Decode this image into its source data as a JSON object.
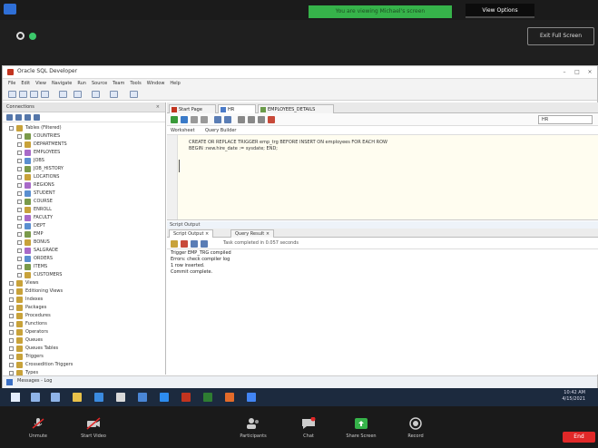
{
  "zoom_top": {
    "share_banner": "You are viewing Michael's screen",
    "view_options": "View Options",
    "full_screen": "Exit Full Screen"
  },
  "window": {
    "title": "Oracle SQL Developer",
    "minimize": "–",
    "maximize": "□",
    "close": "×"
  },
  "menubar": [
    "File",
    "Edit",
    "View",
    "Navigate",
    "Run",
    "Source",
    "Team",
    "Tools",
    "Window",
    "Help"
  ],
  "connections": {
    "header": "Connections",
    "close": "×",
    "tree": [
      {
        "label": "Tables (Filtered)",
        "depth": 0
      },
      {
        "label": "COUNTRIES",
        "depth": 1
      },
      {
        "label": "DEPARTMENTS",
        "depth": 1
      },
      {
        "label": "EMPLOYEES",
        "depth": 1
      },
      {
        "label": "JOBS",
        "depth": 1
      },
      {
        "label": "JOB_HISTORY",
        "depth": 1
      },
      {
        "label": "LOCATIONS",
        "depth": 1
      },
      {
        "label": "REGIONS",
        "depth": 1
      },
      {
        "label": "STUDENT",
        "depth": 1
      },
      {
        "label": "COURSE",
        "depth": 1
      },
      {
        "label": "ENROLL",
        "depth": 1
      },
      {
        "label": "FACULTY",
        "depth": 1
      },
      {
        "label": "DEPT",
        "depth": 1
      },
      {
        "label": "EMP",
        "depth": 1
      },
      {
        "label": "BONUS",
        "depth": 1
      },
      {
        "label": "SALGRADE",
        "depth": 1
      },
      {
        "label": "ORDERS",
        "depth": 1
      },
      {
        "label": "ITEMS",
        "depth": 1
      },
      {
        "label": "CUSTOMERS",
        "depth": 1
      },
      {
        "label": "Views",
        "depth": 0
      },
      {
        "label": "Editioning Views",
        "depth": 0
      },
      {
        "label": "Indexes",
        "depth": 0
      },
      {
        "label": "Packages",
        "depth": 0
      },
      {
        "label": "Procedures",
        "depth": 0
      },
      {
        "label": "Functions",
        "depth": 0
      },
      {
        "label": "Operators",
        "depth": 0
      },
      {
        "label": "Queues",
        "depth": 0
      },
      {
        "label": "Queues Tables",
        "depth": 0
      },
      {
        "label": "Triggers",
        "depth": 0
      },
      {
        "label": "Crossedition Triggers",
        "depth": 0
      },
      {
        "label": "Types",
        "depth": 0
      },
      {
        "label": "Sequences",
        "depth": 0
      },
      {
        "label": "Synonyms",
        "depth": 0
      }
    ]
  },
  "editor": {
    "tabs": [
      "Start Page",
      "HR",
      "EMPLOYEES_DETAILS"
    ],
    "connection": "HR",
    "worksheet_tabs": [
      "Worksheet",
      "Query Builder"
    ],
    "code_lines": [
      "CREATE OR REPLACE TRIGGER emp_trg BEFORE INSERT ON employees FOR EACH ROW",
      "BEGIN :new.hire_date := sysdate; END;"
    ],
    "output_label": "Script Output",
    "output_tabs": [
      "Script Output ×",
      "Query Result ×"
    ],
    "task_text": "Task completed in 0.057 seconds",
    "output_lines": [
      "Trigger EMP_TRG compiled",
      "",
      "Errors: check compiler log",
      "1 row inserted.",
      "Commit complete."
    ]
  },
  "status": {
    "messages": "Messages - Log"
  },
  "taskbar": {
    "time": "10:42 AM",
    "date": "4/15/2021"
  },
  "zoom_bottom": {
    "items": [
      "Unmute",
      "Start Video",
      "Participants",
      "Chat",
      "Share Screen",
      "Record"
    ],
    "end": "End"
  },
  "colors": {
    "share_green": "#36b34a",
    "end_red": "#e02828",
    "taskbar": "#1c2a3e"
  }
}
